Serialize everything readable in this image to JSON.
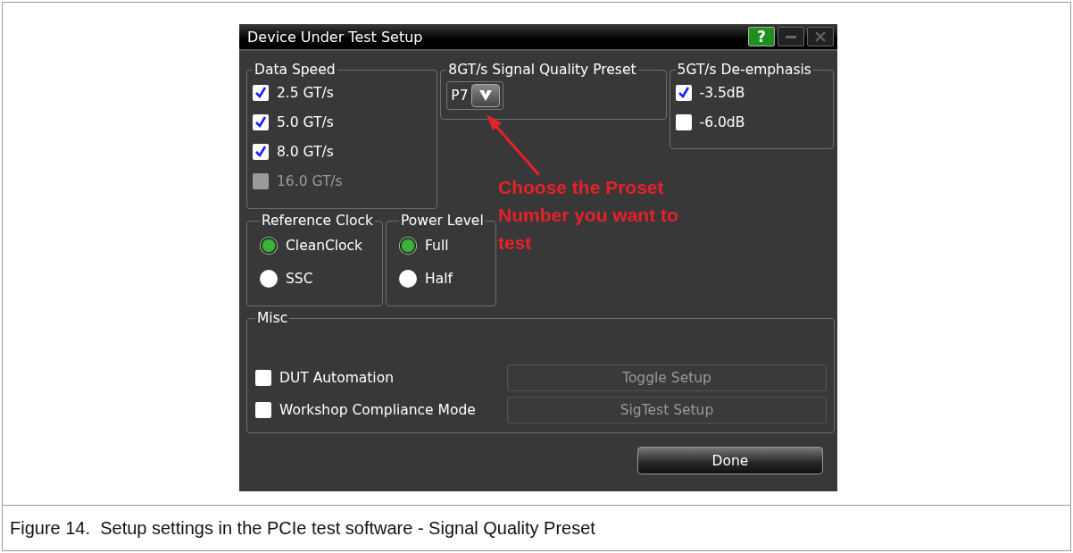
{
  "dialog": {
    "title": "Device Under Test Setup",
    "help": "?",
    "data_speed": {
      "label": "Data Speed",
      "options": [
        {
          "label": "2.5 GT/s",
          "checked": true,
          "disabled": false
        },
        {
          "label": "5.0 GT/s",
          "checked": true,
          "disabled": false
        },
        {
          "label": "8.0 GT/s",
          "checked": true,
          "disabled": false
        },
        {
          "label": "16.0 GT/s",
          "checked": false,
          "disabled": true
        }
      ]
    },
    "preset": {
      "label": "8GT/s Signal Quality Preset",
      "value": "P7"
    },
    "de_emphasis": {
      "label": "5GT/s De-emphasis",
      "options": [
        {
          "label": "-3.5dB",
          "checked": true,
          "disabled": false
        },
        {
          "label": "-6.0dB",
          "checked": false,
          "disabled": false
        }
      ]
    },
    "reference_clock": {
      "label": "Reference Clock",
      "options": [
        {
          "label": "CleanClock",
          "selected": true
        },
        {
          "label": "SSC",
          "selected": false
        }
      ]
    },
    "power_level": {
      "label": "Power Level",
      "options": [
        {
          "label": "Full",
          "selected": true
        },
        {
          "label": "Half",
          "selected": false
        }
      ]
    },
    "misc": {
      "label": "Misc",
      "rows": [
        {
          "label": "DUT Automation",
          "checked": false,
          "button": "Toggle Setup",
          "button_disabled": true
        },
        {
          "label": "Workshop Compliance Mode",
          "checked": false,
          "button": "SigTest Setup",
          "button_disabled": true
        }
      ]
    },
    "done": "Done"
  },
  "annotation": {
    "text": "Choose the Proset Number you want to test"
  },
  "figure": {
    "caption": "Figure 14.  Setup settings in the PCIe test software - Signal Quality Preset"
  }
}
